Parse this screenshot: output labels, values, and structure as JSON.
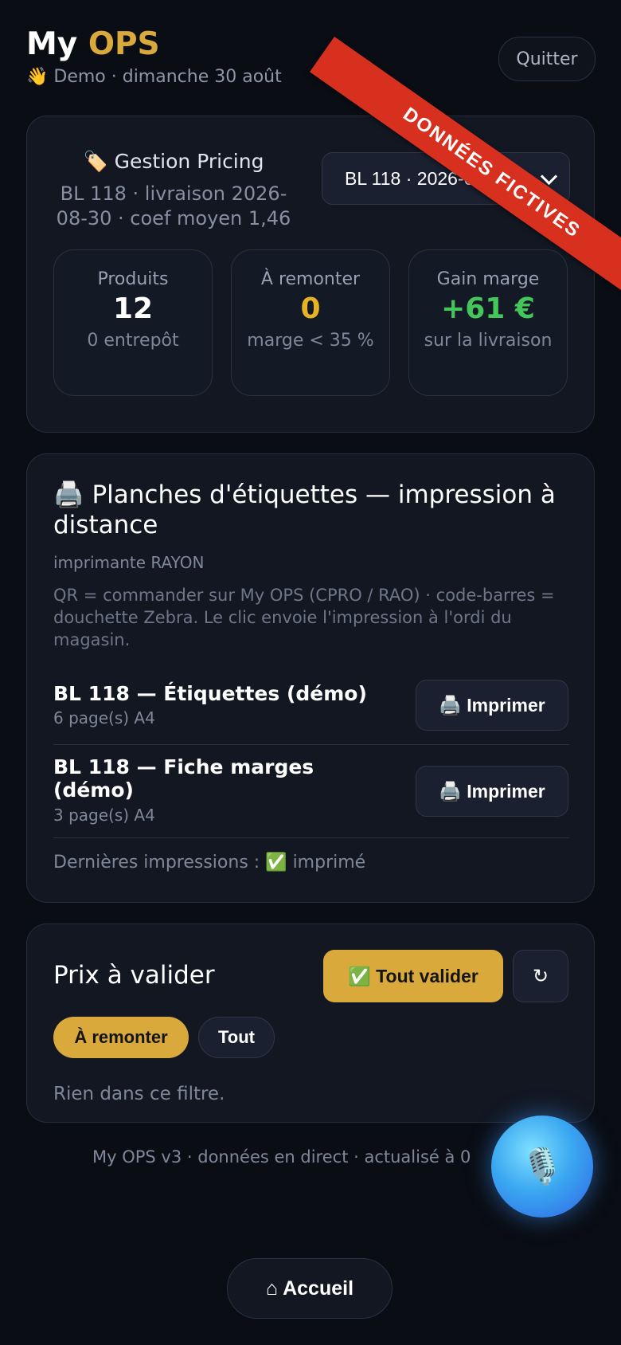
{
  "header": {
    "title_prefix": "My",
    "title_accent": "OPS",
    "subtitle": "👋 Demo · dimanche 30 août",
    "quit_label": "Quitter",
    "ribbon_text": "DONNÉES FICTIVES"
  },
  "pricing": {
    "title": "🏷️ Gestion Pricing",
    "description": "BL 118 · livraison 2026-08-30 · coef moyen 1,46",
    "select_value": "BL 118 · 2026-08-30",
    "stats": [
      {
        "label": "Produits",
        "value": "12",
        "sub": "0 entrepôt"
      },
      {
        "label": "À remonter",
        "value": "0",
        "sub": "marge < 35 %"
      },
      {
        "label": "Gain marge",
        "value": "+61 €",
        "sub": "sur la livraison"
      }
    ],
    "colors": {
      "warning": "#e8b227",
      "success": "#44c75a"
    }
  },
  "labels_print": {
    "title": "🖨️ Planches d'étiquettes — impression à distance",
    "printer": "imprimante RAYON",
    "description": "QR = commander sur My OPS (CPRO / RAO) · code-barres = douchette Zebra. Le clic envoie l'impression à l'ordi du magasin.",
    "jobs": [
      {
        "title": "BL 118 — Étiquettes (démo)",
        "pages": "6 page(s) A4",
        "button": "🖨️ Imprimer"
      },
      {
        "title": "BL 118 — Fiche marges (démo)",
        "pages": "3 page(s) A4",
        "button": "🖨️ Imprimer"
      }
    ],
    "last_prints": "Dernières impressions : ✅ imprimé"
  },
  "validation": {
    "title": "Prix à valider",
    "validate_all": "✅ Tout valider",
    "refresh_icon": "↻",
    "filters": [
      "À remonter",
      "Tout"
    ],
    "empty": "Rien dans ce filtre."
  },
  "footer": {
    "text": "My OPS v3 · données en direct · actualisé à 0",
    "mic_icon": "🎙️",
    "home_label": "⌂ Accueil"
  },
  "brand": {
    "accent": "#d9a93b",
    "ribbon": "#d8301f"
  }
}
